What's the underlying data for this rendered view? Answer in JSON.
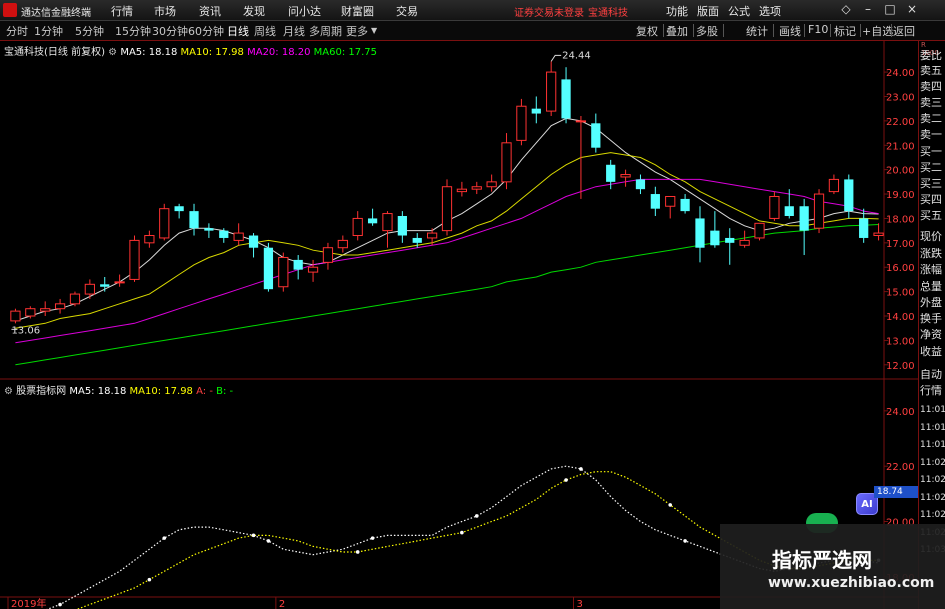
{
  "app": {
    "name": "通达信金融终端",
    "menus": [
      "行情",
      "市场",
      "资讯",
      "发现",
      "问小达",
      "财富圈",
      "交易"
    ],
    "status_text": "证券交易未登录",
    "status_company": "宝通科技",
    "right_menus": [
      "功能",
      "版面",
      "公式",
      "选项"
    ],
    "window_buttons": [
      "bell-icon",
      "minimize-icon",
      "restore-icon",
      "close-icon"
    ]
  },
  "periods": {
    "items": [
      "分时",
      "1分钟",
      "5分钟",
      "15分钟",
      "30分钟",
      "60分钟",
      "日线",
      "周线",
      "月线",
      "多周期",
      "更多"
    ],
    "active": "日线"
  },
  "toolbar_right": [
    "复权",
    "叠加",
    "多股",
    "统计",
    "画线",
    "F10",
    "标记",
    "+自选",
    "返回"
  ],
  "main_legend": {
    "title": "宝通科技(日线 前复权)",
    "ma5": "MA5: 18.18",
    "ma10": "MA10: 17.98",
    "ma20": "MA20: 18.20",
    "ma60": "MA60: 17.75"
  },
  "sub_legend": {
    "title": "股票指标网",
    "ma5": "MA5: 18.18",
    "ma10": "MA10: 17.98",
    "a": "A: -",
    "b": "B: -"
  },
  "side_panel": {
    "code": "R 1000",
    "items": [
      "委比",
      "卖五",
      "卖四",
      "卖三",
      "卖二",
      "卖一",
      "买一",
      "买二",
      "买三",
      "买四",
      "买五",
      "现价",
      "涨跌",
      "涨幅",
      "总量",
      "外盘",
      "换手",
      "净资",
      "收益",
      "自动",
      "行情",
      "11:01",
      "11:01",
      "11:01",
      "11:02",
      "11:02",
      "11:02",
      "11:02",
      "11:02",
      "11:03"
    ]
  },
  "annotations": {
    "high_label": "24.44",
    "low_label": "13.06",
    "price_tag": "18.74",
    "ai_label": "AI"
  },
  "watermark": {
    "title": "指标严选网",
    "url": "www.xuezhibiao.com"
  },
  "colors": {
    "up": "#ff3232",
    "down": "#54ffff",
    "ma5": "#ffffff",
    "ma10": "#ffff00",
    "ma20": "#ff00ff",
    "ma60": "#00ff00",
    "grid": "#7a1010",
    "axis_text": "#ff4040"
  },
  "chart_data": [
    {
      "type": "candlestick",
      "title": "宝通科技(日线 前复权)",
      "ylim": [
        11.5,
        24.7
      ],
      "y_ticks": [
        12.0,
        13.0,
        14.0,
        15.0,
        16.0,
        17.0,
        18.0,
        19.0,
        20.0,
        21.0,
        22.0,
        23.0,
        24.0
      ],
      "x_labels": [
        "2019年",
        "2",
        "3"
      ],
      "x_label_index": [
        0,
        18,
        38
      ],
      "candles": [
        [
          13.8,
          14.3,
          13.7,
          14.2
        ],
        [
          14.0,
          14.4,
          13.9,
          14.3
        ],
        [
          14.2,
          14.6,
          14.0,
          14.3
        ],
        [
          14.3,
          14.7,
          14.1,
          14.5
        ],
        [
          14.5,
          15.0,
          14.4,
          14.9
        ],
        [
          14.9,
          15.5,
          14.7,
          15.3
        ],
        [
          15.3,
          15.6,
          15.0,
          15.2
        ],
        [
          15.4,
          15.7,
          15.2,
          15.4
        ],
        [
          15.5,
          17.3,
          15.4,
          17.1
        ],
        [
          17.0,
          17.5,
          16.8,
          17.3
        ],
        [
          17.2,
          18.6,
          17.1,
          18.4
        ],
        [
          18.5,
          18.6,
          18.0,
          18.3
        ],
        [
          18.3,
          18.6,
          17.3,
          17.6
        ],
        [
          17.6,
          17.8,
          17.2,
          17.5
        ],
        [
          17.5,
          17.6,
          17.0,
          17.2
        ],
        [
          17.1,
          17.8,
          16.9,
          17.4
        ],
        [
          17.3,
          17.4,
          16.4,
          16.8
        ],
        [
          16.8,
          17.0,
          15.0,
          15.1
        ],
        [
          15.2,
          16.6,
          15.0,
          16.4
        ],
        [
          16.3,
          16.5,
          15.5,
          15.9
        ],
        [
          15.8,
          16.3,
          15.4,
          16.0
        ],
        [
          16.2,
          17.0,
          15.9,
          16.8
        ],
        [
          16.8,
          17.3,
          16.6,
          17.1
        ],
        [
          17.3,
          18.3,
          17.1,
          18.0
        ],
        [
          18.0,
          18.4,
          17.7,
          17.8
        ],
        [
          17.5,
          18.3,
          16.8,
          18.2
        ],
        [
          18.1,
          18.3,
          17.0,
          17.3
        ],
        [
          17.2,
          17.4,
          16.8,
          17.0
        ],
        [
          17.2,
          17.6,
          16.9,
          17.4
        ],
        [
          17.5,
          19.6,
          17.3,
          19.3
        ],
        [
          19.1,
          19.5,
          18.9,
          19.2
        ],
        [
          19.2,
          19.5,
          19.0,
          19.3
        ],
        [
          19.3,
          19.8,
          19.1,
          19.5
        ],
        [
          19.5,
          21.5,
          19.2,
          21.1
        ],
        [
          21.2,
          22.9,
          21.0,
          22.6
        ],
        [
          22.5,
          23.0,
          21.9,
          22.3
        ],
        [
          22.4,
          24.44,
          22.2,
          24.0
        ],
        [
          23.7,
          24.2,
          21.9,
          22.1
        ],
        [
          22.0,
          22.2,
          18.8,
          22.0
        ],
        [
          21.9,
          22.3,
          20.7,
          20.9
        ],
        [
          20.2,
          20.4,
          19.2,
          19.5
        ],
        [
          19.7,
          20.0,
          19.3,
          19.8
        ],
        [
          19.6,
          19.8,
          19.0,
          19.2
        ],
        [
          19.0,
          19.3,
          18.1,
          18.4
        ],
        [
          18.5,
          18.9,
          18.0,
          18.9
        ],
        [
          18.8,
          19.0,
          18.2,
          18.3
        ],
        [
          18.0,
          18.5,
          16.2,
          16.8
        ],
        [
          17.5,
          18.3,
          16.8,
          16.9
        ],
        [
          17.2,
          17.6,
          16.1,
          17.0
        ],
        [
          16.9,
          17.5,
          16.8,
          17.1
        ],
        [
          17.2,
          17.8,
          17.1,
          17.8
        ],
        [
          18.0,
          19.1,
          17.9,
          18.9
        ],
        [
          18.5,
          19.2,
          18.0,
          18.1
        ],
        [
          18.5,
          18.8,
          16.5,
          17.5
        ],
        [
          17.6,
          19.2,
          17.4,
          19.0
        ],
        [
          19.1,
          19.8,
          19.0,
          19.6
        ],
        [
          19.6,
          19.8,
          18.0,
          18.3
        ],
        [
          18.0,
          18.4,
          17.0,
          17.2
        ],
        [
          17.3,
          17.8,
          17.1,
          17.4
        ]
      ],
      "series": [
        {
          "name": "MA5",
          "values": [
            13.8,
            14.0,
            14.2,
            14.3,
            14.5,
            14.8,
            15.1,
            15.4,
            15.8,
            16.3,
            16.9,
            17.4,
            17.6,
            17.6,
            17.5,
            17.3,
            17.1,
            16.8,
            16.4,
            16.2,
            16.1,
            16.2,
            16.5,
            16.8,
            17.1,
            17.4,
            17.5,
            17.5,
            17.5,
            17.9,
            18.2,
            18.6,
            19.0,
            19.6,
            20.4,
            21.1,
            21.8,
            22.1,
            22.0,
            21.7,
            21.2,
            20.7,
            20.3,
            19.9,
            19.6,
            19.2,
            18.8,
            18.4,
            18.0,
            17.7,
            17.5,
            17.6,
            17.8,
            17.9,
            18.0,
            18.2,
            18.3,
            18.2,
            18.18
          ]
        },
        {
          "name": "MA10",
          "values": [
            13.5,
            13.6,
            13.7,
            13.9,
            14.0,
            14.1,
            14.3,
            14.5,
            14.7,
            14.9,
            15.3,
            15.7,
            16.1,
            16.4,
            16.6,
            16.9,
            17.0,
            17.1,
            17.0,
            16.9,
            16.7,
            16.6,
            16.5,
            16.5,
            16.6,
            16.7,
            16.8,
            16.9,
            17.0,
            17.2,
            17.4,
            17.7,
            17.9,
            18.3,
            18.8,
            19.3,
            19.8,
            20.2,
            20.5,
            20.6,
            20.7,
            20.6,
            20.5,
            20.2,
            19.8,
            19.5,
            19.1,
            18.8,
            18.5,
            18.2,
            17.9,
            17.8,
            17.7,
            17.7,
            17.8,
            17.9,
            18.0,
            18.0,
            17.98
          ]
        },
        {
          "name": "MA20",
          "values": [
            12.9,
            13.0,
            13.1,
            13.2,
            13.3,
            13.4,
            13.5,
            13.6,
            13.7,
            13.9,
            14.1,
            14.3,
            14.5,
            14.7,
            14.9,
            15.1,
            15.3,
            15.5,
            15.7,
            15.9,
            16.1,
            16.2,
            16.3,
            16.4,
            16.5,
            16.6,
            16.7,
            16.8,
            16.9,
            17.0,
            17.2,
            17.4,
            17.6,
            17.8,
            18.0,
            18.3,
            18.6,
            18.9,
            19.1,
            19.3,
            19.4,
            19.5,
            19.6,
            19.6,
            19.6,
            19.6,
            19.6,
            19.5,
            19.4,
            19.3,
            19.2,
            19.1,
            19.0,
            18.9,
            18.7,
            18.6,
            18.5,
            18.3,
            18.2
          ]
        },
        {
          "name": "MA60",
          "values": [
            12.0,
            12.1,
            12.2,
            12.3,
            12.4,
            12.5,
            12.6,
            12.7,
            12.8,
            12.9,
            13.0,
            13.1,
            13.2,
            13.3,
            13.4,
            13.5,
            13.6,
            13.7,
            13.8,
            13.9,
            14.0,
            14.1,
            14.2,
            14.3,
            14.4,
            14.5,
            14.6,
            14.7,
            14.8,
            14.9,
            15.0,
            15.1,
            15.2,
            15.4,
            15.5,
            15.6,
            15.8,
            15.9,
            16.0,
            16.2,
            16.3,
            16.4,
            16.5,
            16.6,
            16.7,
            16.8,
            16.9,
            17.0,
            17.1,
            17.2,
            17.3,
            17.4,
            17.45,
            17.5,
            17.6,
            17.65,
            17.7,
            17.72,
            17.75
          ]
        }
      ]
    },
    {
      "type": "line",
      "title": "股票指标网",
      "ylim": [
        17.2,
        24.5
      ],
      "y_ticks": [
        18.0,
        20.0,
        22.0,
        24.0
      ],
      "series": [
        {
          "name": "MA5",
          "values": [
            16.2,
            16.5,
            16.8,
            17.0,
            17.3,
            17.6,
            17.9,
            18.2,
            18.6,
            19.0,
            19.4,
            19.7,
            19.8,
            19.8,
            19.7,
            19.6,
            19.5,
            19.3,
            19.0,
            18.9,
            18.8,
            18.9,
            19.0,
            19.2,
            19.4,
            19.5,
            19.5,
            19.5,
            19.5,
            19.8,
            20.0,
            20.2,
            20.5,
            20.9,
            21.3,
            21.6,
            21.9,
            22.0,
            21.9,
            21.5,
            20.9,
            20.4,
            20.0,
            19.7,
            19.5,
            19.3,
            19.1,
            18.9,
            18.7,
            18.5,
            18.3,
            18.2,
            18.3,
            18.4,
            18.5,
            18.6,
            18.7,
            18.6,
            18.5
          ]
        },
        {
          "name": "MA10",
          "values": [
            16.0,
            16.2,
            16.4,
            16.6,
            16.8,
            17.0,
            17.2,
            17.4,
            17.6,
            17.9,
            18.2,
            18.5,
            18.8,
            19.0,
            19.2,
            19.4,
            19.5,
            19.5,
            19.4,
            19.3,
            19.1,
            19.0,
            18.9,
            18.9,
            19.0,
            19.1,
            19.2,
            19.3,
            19.4,
            19.5,
            19.6,
            19.8,
            20.0,
            20.2,
            20.5,
            20.8,
            21.2,
            21.5,
            21.7,
            21.8,
            21.8,
            21.6,
            21.3,
            21.0,
            20.6,
            20.2,
            19.8,
            19.5,
            19.2,
            18.9,
            18.6,
            18.4,
            18.3,
            18.3,
            18.4,
            18.5,
            18.6,
            18.6,
            18.6
          ]
        }
      ]
    }
  ]
}
